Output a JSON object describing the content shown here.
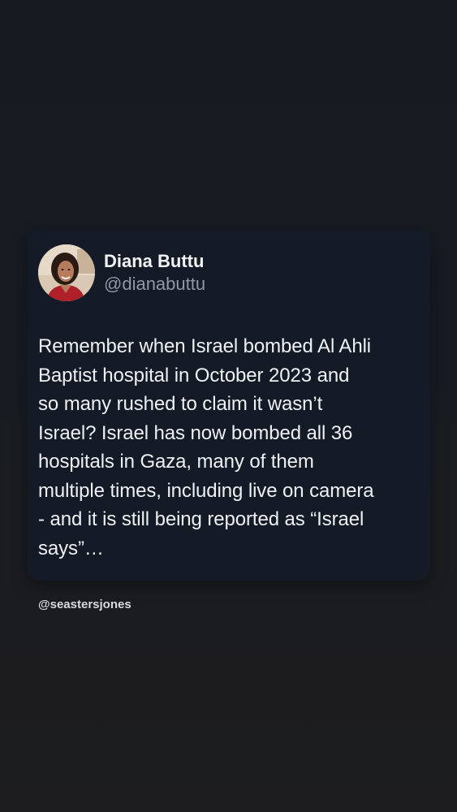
{
  "tweet": {
    "author": {
      "name": "Diana Buttu",
      "handle": "@dianabuttu"
    },
    "text": "Remember when Israel bombed Al Ahli\nBaptist hospital in October 2023 and\nso many rushed to claim it wasn’t\nIsrael? Israel has now bombed all 36\nhospitals in Gaza, many of them\nmultiple times, including live on camera\n- and it is still being reported as “Israel\nsays”…"
  },
  "watermark": "@seastersjones",
  "colors": {
    "background": "#181c22",
    "card": "#151b26",
    "name": "#f1f3f5",
    "handle": "#8f98a3",
    "text": "#eef1f4"
  }
}
